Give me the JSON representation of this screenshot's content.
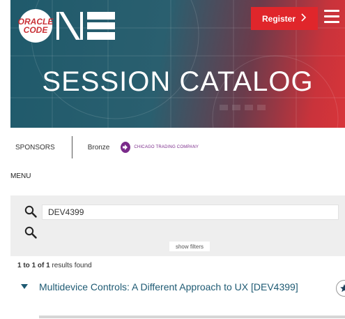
{
  "header": {
    "logo_line1": "ORACLE",
    "logo_line2": "CODE",
    "register_label": "Register",
    "register_icon": "chevron-right-icon",
    "menu_icon": "hamburger-icon",
    "title": "SESSION CATALOG",
    "colors": {
      "teal": "#1f5a6b",
      "red": "#e0262b"
    }
  },
  "sponsors": {
    "label": "SPONSORS",
    "tier": "Bronze",
    "company": "CHICAGO TRADING COMPANY",
    "company_color": "#7a2a8a"
  },
  "menu": {
    "label": "MENU"
  },
  "search": {
    "value": "DEV4399",
    "icon": "search-icon",
    "filters_label": "show filters"
  },
  "results": {
    "count_start": "1",
    "count_to": " to ",
    "count_end": "1",
    "count_of": " of ",
    "count_total": "1",
    "count_suffix": " results found",
    "items": [
      {
        "title": "Multidevice Controls: A Different Approach to UX [DEV4399]",
        "favorite_icon": "star-icon",
        "expand_icon": "caret-down-icon"
      }
    ]
  }
}
